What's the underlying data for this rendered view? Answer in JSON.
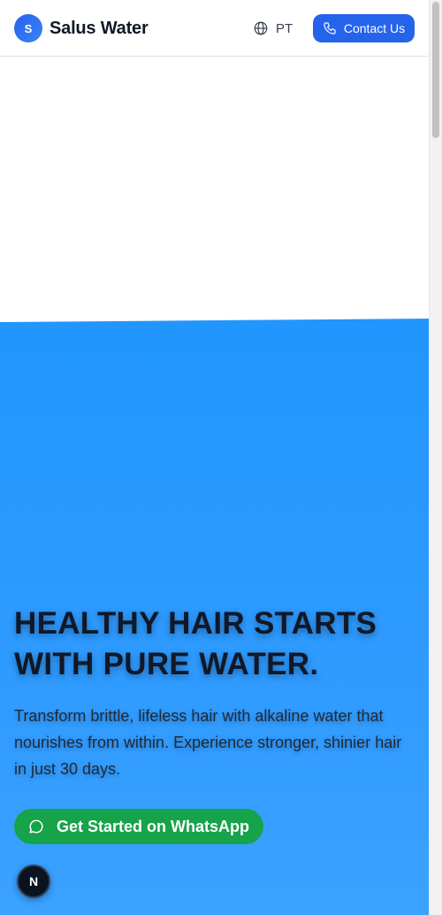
{
  "header": {
    "logo_letter": "S",
    "brand_name": "Salus Water",
    "language_label": "PT",
    "contact_button_label": "Contact Us"
  },
  "hero": {
    "title": "HEALTHY HAIR STARTS WITH PURE WATER.",
    "subtitle": "Transform brittle, lifeless hair with alkaline water that nourishes from within. Experience stronger, shinier hair in just 30 days.",
    "cta_label": "Get Started on WhatsApp"
  },
  "badge": {
    "letter": "N"
  },
  "colors": {
    "accent": "#2563eb",
    "hero_background": "#2196ff",
    "whatsapp_green": "#16a34a"
  },
  "icons": {
    "language": "globe-icon",
    "contact": "phone-icon",
    "cta": "chat-bubble-icon"
  }
}
